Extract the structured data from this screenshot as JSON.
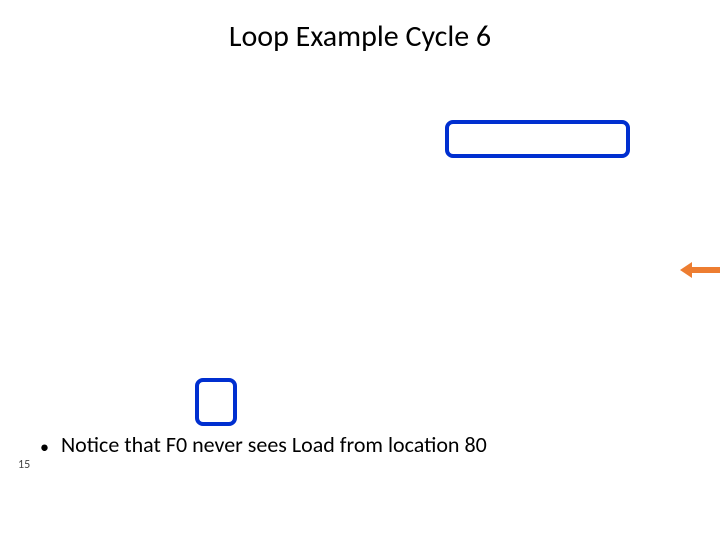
{
  "title": "Loop Example Cycle 6",
  "bullet_text": "Notice that F0 never sees Load from location 80",
  "page_number": "15"
}
